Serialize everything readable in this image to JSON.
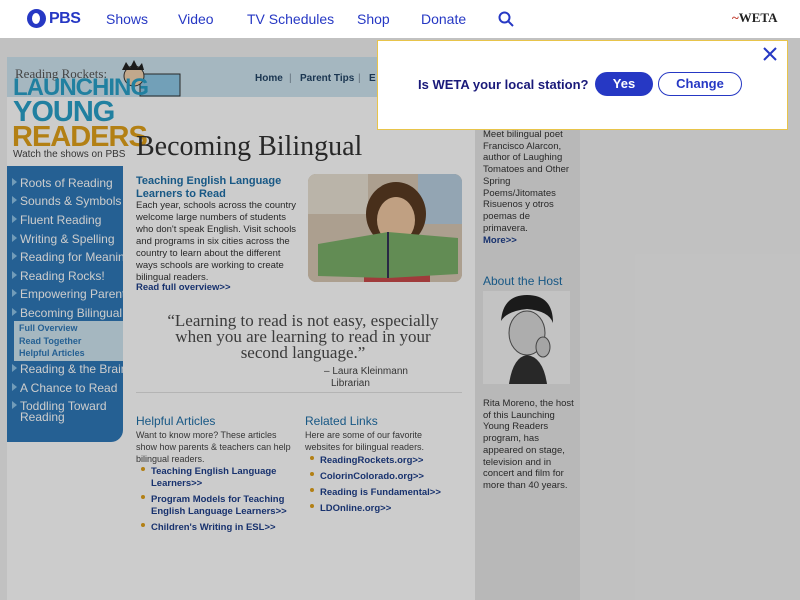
{
  "pbs_bar": {
    "logo_text": "PBS",
    "nav": [
      "Shows",
      "Video",
      "TV Schedules",
      "Shop",
      "Donate"
    ],
    "station_logo": "WETA"
  },
  "header": {
    "small_logo": "Reading Rockets:",
    "launching": "LAUNCHING",
    "young": "YOUNG",
    "readers": "READERS",
    "watch": "Watch the shows on PBS",
    "top_nav": [
      "Home",
      "Parent Tips",
      "E"
    ]
  },
  "sidebar": {
    "items": [
      "Roots of Reading",
      "Sounds & Symbols",
      "Fluent Reading",
      "Writing & Spelling",
      "Reading for Meaning",
      "Reading Rocks!",
      "Empowering Parents",
      "Becoming Bilingual"
    ],
    "sub_items": [
      "Full Overview",
      "Read Together",
      "Helpful Articles"
    ],
    "items_after": [
      "Reading & the Brain",
      "A Chance to Read",
      "Toddling Toward",
      "Reading"
    ]
  },
  "main": {
    "title": "Becoming Bilingual",
    "feature_title": "Teaching English Language Learners to Read",
    "feature_body": "Each year, schools across the country welcome large numbers of students who don't speak English. Visit schools and programs in six cities across the country to learn about the different ways schools are working to create bilingual readers.",
    "feature_link": "Read full overview>>",
    "quote": "“Learning to read is not easy, especially when you are learning to read in your second language.”",
    "quote_author": "– Laura Kleinmann",
    "quote_role": "Librarian",
    "helpful": {
      "heading": "Helpful Articles",
      "desc": "Want to know more? These articles show how parents & teachers can help bilingual readers.",
      "links": [
        "Teaching English Language Learners>>",
        "Program Models for Teaching English Language Learners>>",
        "Children's Writing in ESL>>"
      ]
    },
    "related": {
      "heading": "Related Links",
      "desc": "Here are some of our favorite websites for bilingual readers.",
      "links": [
        "ReadingRockets.org>>",
        "ColorinColorado.org>>",
        "Reading is Fundamental>>",
        "LDOnline.org>>"
      ]
    }
  },
  "right": {
    "intro": "Meet bilingual poet Francisco Alarcon, author of Laughing Tomatoes and Other Spring Poems/Jitomates Risuenos y otros poemas de primavera.",
    "more": "More>>",
    "host_heading": "About the Host",
    "bio": "Rita Moreno, the host of this Launching Young Readers program, has appeared on stage, television and in concert and film for more than 40 years."
  },
  "modal": {
    "question": "Is WETA your local station?",
    "yes": "Yes",
    "change": "Change"
  },
  "colors": {
    "pbs_blue": "#2638c4",
    "sidebar_blue": "#2f79b8",
    "accent_gold": "#e0a01a"
  }
}
